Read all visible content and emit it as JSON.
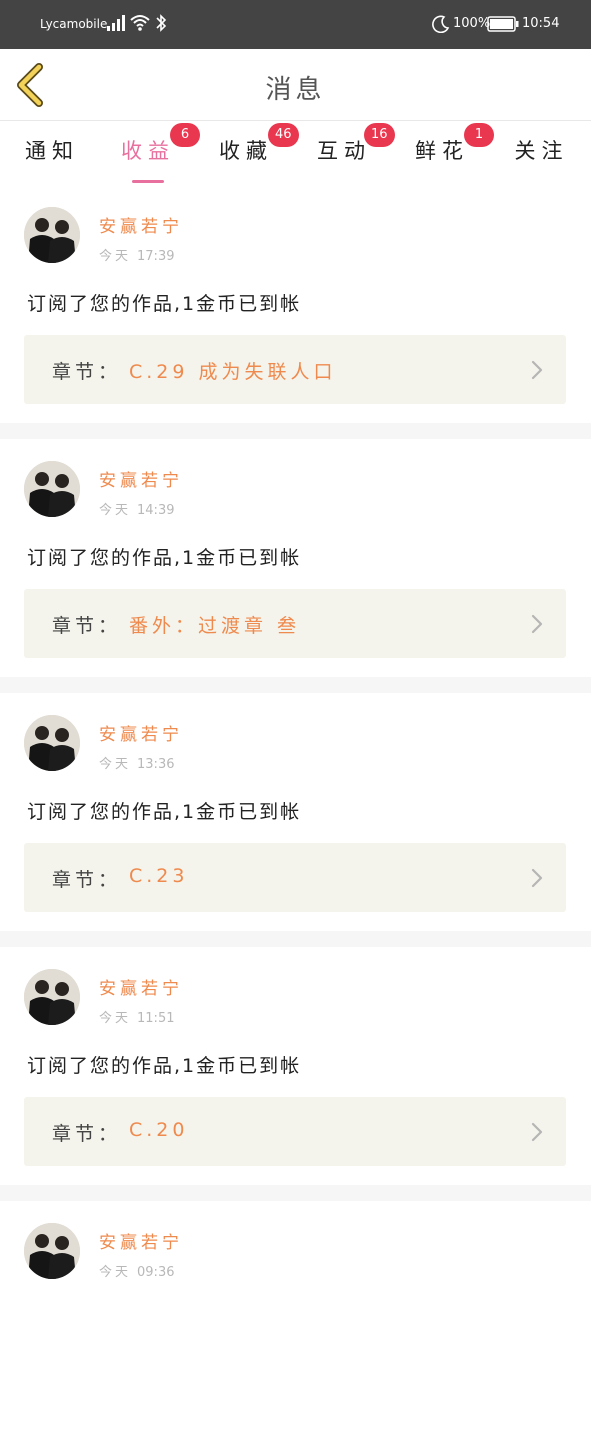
{
  "status_bar": {
    "carrier": "Lycamobile",
    "battery": "100%",
    "time": "10:54"
  },
  "header": {
    "title": "消息",
    "back_icon": "chevron-left-icon"
  },
  "tabs": [
    {
      "label": "通知",
      "badge": ""
    },
    {
      "label": "收益",
      "badge": "6",
      "active": true
    },
    {
      "label": "收藏",
      "badge": "46"
    },
    {
      "label": "互动",
      "badge": "16"
    },
    {
      "label": "鲜花",
      "badge": "1"
    },
    {
      "label": "关注",
      "badge": ""
    }
  ],
  "colors": {
    "active_tab": "#e8709f",
    "badge": "#e8374f",
    "accent_orange": "#ef8a4e",
    "chapter_bg": "#f4f4ec",
    "status_bar": "#444444"
  },
  "messages": [
    {
      "username": "安赢若宁",
      "day": "今天",
      "time": "17:39",
      "text": "订阅了您的作品,1金币已到帐",
      "chapter_label": "章节：",
      "chapter_title": "C.29 成为失联人口"
    },
    {
      "username": "安赢若宁",
      "day": "今天",
      "time": "14:39",
      "text": "订阅了您的作品,1金币已到帐",
      "chapter_label": "章节：",
      "chapter_title": "番外：过渡章 叁"
    },
    {
      "username": "安赢若宁",
      "day": "今天",
      "time": "13:36",
      "text": "订阅了您的作品,1金币已到帐",
      "chapter_label": "章节：",
      "chapter_title": "C.23"
    },
    {
      "username": "安赢若宁",
      "day": "今天",
      "time": "11:51",
      "text": "订阅了您的作品,1金币已到帐",
      "chapter_label": "章节：",
      "chapter_title": "C.20"
    },
    {
      "username": "安赢若宁",
      "day": "今天",
      "time": "09:36",
      "text": "",
      "chapter_label": "",
      "chapter_title": ""
    }
  ]
}
